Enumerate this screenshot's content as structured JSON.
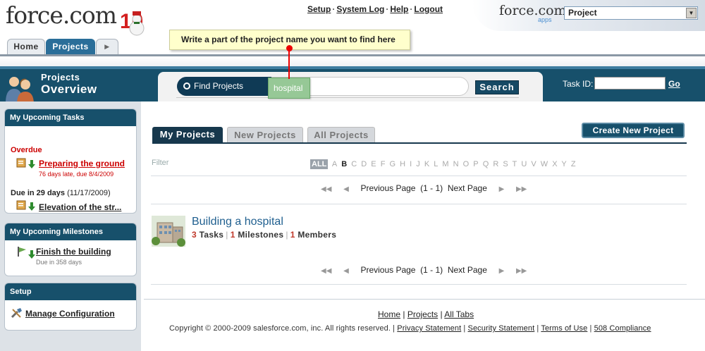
{
  "header": {
    "logo_text": "force.com",
    "logo_badge": "10",
    "links": [
      "Setup",
      "System Log",
      "Help",
      "Logout"
    ],
    "brand_text": "force.com",
    "brand_sub": "apps",
    "app_selector": "Project"
  },
  "tabs": {
    "home": "Home",
    "projects": "Projects",
    "more": "▶"
  },
  "tooltip": "Write a part of the project name you want to find here",
  "page_heading": {
    "line1": "Projects",
    "line2": "Overview"
  },
  "search": {
    "label": "Find Projects",
    "value": "hospital",
    "button": "Search",
    "task_id_label": "Task ID:",
    "go": "Go"
  },
  "sidebar": {
    "tasks": {
      "title": "My Upcoming Tasks",
      "overdue_label": "Overdue",
      "overdue_task": "Preparing the ground",
      "overdue_sub": "76 days late, due 8/4/2009",
      "due_label": "Due in 29 days",
      "due_date": "(11/17/2009)",
      "due_task": "Elevation of the str..."
    },
    "milestones": {
      "title": "My Upcoming Milestones",
      "item": "Finish the building",
      "sub": "Due in 358 days"
    },
    "setup": {
      "title": "Setup",
      "item": "Manage Configuration"
    }
  },
  "project_tabs": [
    "My Projects",
    "New Projects",
    "All Projects"
  ],
  "new_project_button": "Create New Project",
  "filter": {
    "label": "Filter",
    "all": "ALL",
    "letters": [
      "A",
      "B",
      "C",
      "D",
      "E",
      "F",
      "G",
      "H",
      "I",
      "J",
      "K",
      "L",
      "M",
      "N",
      "O",
      "P",
      "Q",
      "R",
      "S",
      "T",
      "U",
      "V",
      "W",
      "X",
      "Y",
      "Z"
    ]
  },
  "pager": {
    "prev": "Previous Page",
    "range": "(1 - 1)",
    "next": "Next Page"
  },
  "project": {
    "name": "Building a hospital",
    "tasks_count": "3",
    "tasks_label": "Tasks",
    "milestones_count": "1",
    "milestones_label": "Milestones",
    "members_count": "1",
    "members_label": "Members"
  },
  "footer": {
    "links": [
      "Home",
      "Projects",
      "All Tabs"
    ],
    "copyright": "Copyright © 2000-2009 salesforce.com, inc. All rights reserved.",
    "legal": [
      "Privacy Statement",
      "Security Statement",
      "Terms of Use",
      "508 Compliance"
    ]
  },
  "colors": {
    "band": "#17506b",
    "link_blue": "#1f5f8f",
    "overdue_red": "#cc0000",
    "count_red": "#c0392b"
  }
}
